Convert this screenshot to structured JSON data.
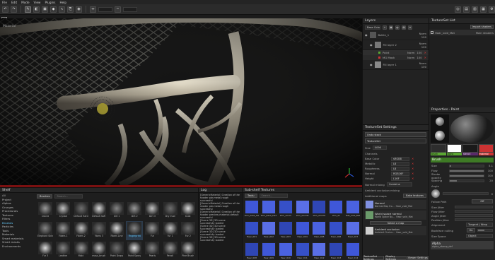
{
  "menu": [
    "File",
    "Edit",
    "Mode",
    "View",
    "Plugins",
    "Help"
  ],
  "viewport": {
    "label": "Material"
  },
  "layers_panel": {
    "title": "Layers",
    "channel": "Base Colo",
    "items": [
      {
        "name": "Bottle_1",
        "mode": "Norm",
        "opacity": "100"
      },
      {
        "name": "Fill layer 2",
        "mode": "Norm",
        "opacity": "100"
      },
      {
        "name": "Paint",
        "mode": "Norm",
        "opacity": "100"
      },
      {
        "name": "MG Mask",
        "mode": "Norm",
        "opacity": "100"
      },
      {
        "name": "Fill layer 1",
        "mode": "Norm",
        "opacity": "100"
      }
    ]
  },
  "textureset_list": {
    "title": "TextureSet List",
    "button": "Import shaders",
    "item": "Haar_void_Mat",
    "shader": "Main shaders"
  },
  "textureset_settings": {
    "title": "TextureSet Settings",
    "undo": "Undo stack",
    "sub": "TextureSet",
    "size_label": "Size",
    "size_value": "4096",
    "channels_title": "Channels",
    "channels": [
      {
        "name": "Base Color",
        "format": "sRGB8"
      },
      {
        "name": "Metallic",
        "format": "L8"
      },
      {
        "name": "Roughness",
        "format": "L8"
      },
      {
        "name": "Normal",
        "format": "RGB16F"
      },
      {
        "name": "Height",
        "format": "L16F"
      }
    ],
    "normal_mixing_label": "Normal mixing",
    "normal_mixing_value": "Combine",
    "ao_label": "Ambient occlusion mixing",
    "additional_maps": "Additional maps",
    "bake_button": "Bake textures",
    "maps": [
      {
        "name": "Normal",
        "label": "Normal Map fro...",
        "value": "Haar_void_Mat"
      },
      {
        "name": "World space normal",
        "label": "World Space No...",
        "value": "Haar_void_Mat"
      },
      {
        "name": "Ambient occlusion",
        "label": "Ambient Occlus...",
        "value": "Haar_void_Mat"
      }
    ],
    "select_map": "Select a map",
    "tabs": [
      "TextureSet Settings",
      "Display Settings",
      "Viewer Settings"
    ]
  },
  "properties": {
    "title": "Properties - Paint",
    "material_labels": [
      "brush",
      "alpha",
      "stencil",
      "material"
    ],
    "section_brush": "Brush",
    "params": [
      {
        "label": "Size",
        "value": "5.1"
      },
      {
        "label": "Flow",
        "value": "100"
      },
      {
        "label": "Stroke opacity",
        "value": "100"
      },
      {
        "label": "Spacing",
        "value": "20"
      }
    ],
    "angle_label": "Angle",
    "angle_value": "0",
    "follow_path_label": "Follow Path",
    "follow_path_value": "Off",
    "jitters": [
      "Size Jitter",
      "Flow Jitter",
      "Angle Jitter",
      "Position Jitter"
    ],
    "alignment_label": "Alignment",
    "alignment_value": "Tangent | Wrap",
    "backface_label": "Backface culling",
    "backface_value": "On",
    "size_space_label": "Size Space",
    "size_space_value": "Object",
    "alpha_title": "Alpha",
    "alpha_name": "alpha_stamp_def"
  },
  "shelf": {
    "title": "Shelf",
    "search_tab": "Brushes",
    "search_placeholder": "Search...",
    "categories": [
      "All",
      "Project",
      "Alphas",
      "Grunges",
      "Procedurals",
      "Textures",
      "Filters",
      "Brushes",
      "Particles",
      "Tools",
      "Materials",
      "Smart materials",
      "Smart masks",
      "Environments"
    ],
    "active_category": "Brushes",
    "items": [
      "Cracks",
      "Crystal",
      "Default Hard",
      "Default Soft",
      "Dirt 1",
      "Dirt 2",
      "Dirt 3",
      "Dry mud",
      "Dust",
      "Elephant Skin",
      "Fibers 1",
      "Fibers 2",
      "Fibers 3",
      "Fibers Line",
      "Fingerprint",
      "Fur",
      "Fur 1",
      "Fur 2",
      "Fur 3",
      "Leather",
      "Mold",
      "moss_brush",
      "Paint Drops",
      "Paint Spray",
      "Pearls",
      "Pencil",
      "Pine Brush"
    ],
    "active_item": "Fingerprint"
  },
  "log": {
    "title": "Log",
    "entries": [
      "[GenericMaterial] Creation of the shader pbr-metal-rough successful",
      "[GenericMaterial] Creation of the shader pbr-metal-rough successful",
      "[GenericMaterial] Creation of the shader preview-material-default successful",
      "[Scene 3D] 3D scene successfully loaded",
      "[Scene 3D] 3D scene successfully loaded",
      "[Scene 3D] 3D scene successfully loaded",
      "[Scene 3D] 3D scene successfully loaded"
    ]
  },
  "subshelf": {
    "title": "Sub-shelf Textures",
    "tab": "Textu",
    "search_placeholder": "Search...",
    "items": [
      "shin_base_kw",
      "shin_base_kw2",
      "shin_world",
      "shin_world2",
      "shin_world3",
      "shin_ao",
      "Test_kres_Mat",
      "Haar_001",
      "Haar_002",
      "Haar_003",
      "Haar_004",
      "Haar_005",
      "Haar_006",
      "Haar_007",
      "Haar_008",
      "Haar_009",
      "Haar_010",
      "Haar_011",
      "Haar_012",
      "Haar_013",
      "Haar_014"
    ]
  },
  "colors": {
    "accent_green": "#5aa832",
    "timeline_red": "#7a1010",
    "texture_blue": "#3f57d8"
  }
}
